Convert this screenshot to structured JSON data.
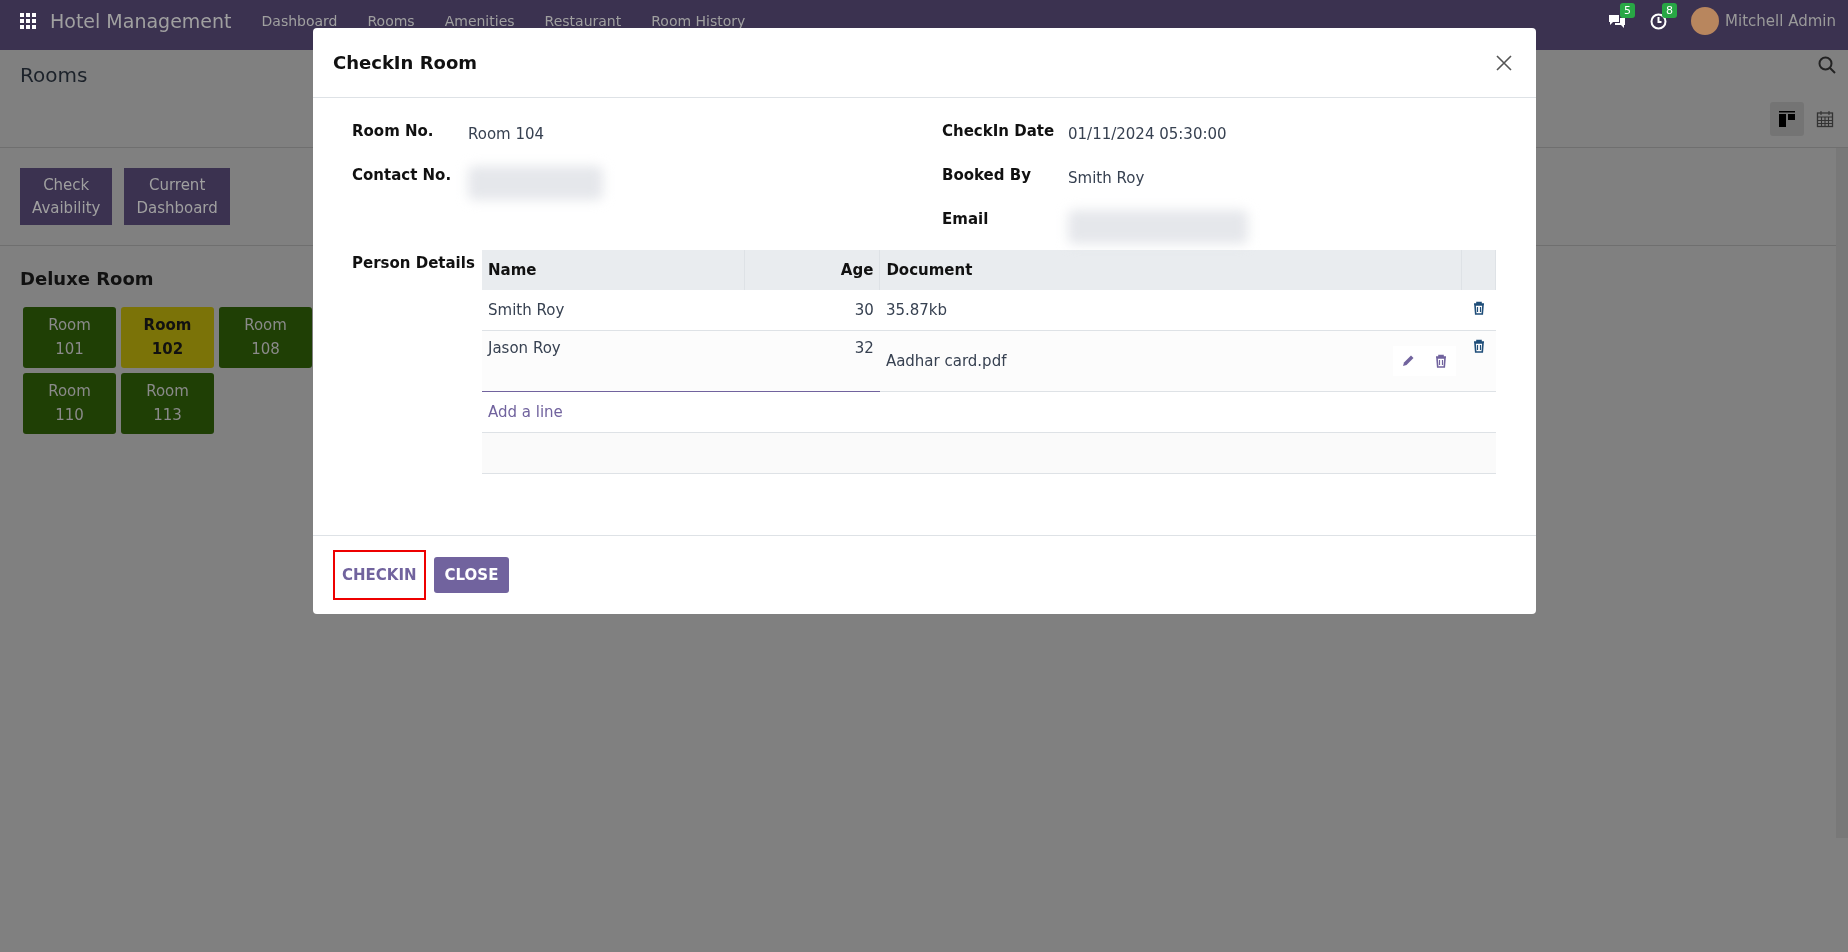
{
  "navbar": {
    "app_title": "Hotel Management",
    "menu": [
      {
        "label": "Dashboard"
      },
      {
        "label": "Rooms"
      },
      {
        "label": "Amenities"
      },
      {
        "label": "Restaurant"
      },
      {
        "label": "Room History"
      }
    ],
    "messages_count": "5",
    "activities_count": "8",
    "user_name": "Mitchell Admin"
  },
  "page": {
    "title": "Rooms",
    "buttons": [
      {
        "lines": [
          "Check",
          "Avaibility"
        ]
      },
      {
        "lines": [
          "Current",
          "Dashboard"
        ]
      }
    ],
    "section_title": "Deluxe Room",
    "rooms": [
      {
        "lines": [
          "Room",
          "101"
        ],
        "color": "#1f3f05"
      },
      {
        "lines": [
          "Room",
          "102"
        ],
        "color": "#7b7308"
      },
      {
        "lines": [
          "Room",
          "108"
        ],
        "color": "#1f3f05"
      },
      {
        "lines": [
          "Room",
          "110"
        ],
        "color": "#1f3f05"
      },
      {
        "lines": [
          "Room",
          "113"
        ],
        "color": "#1f3f05"
      }
    ]
  },
  "dialog": {
    "title": "CheckIn Room",
    "left_fields": [
      {
        "label": "Room No.",
        "value": "Room 104"
      },
      {
        "label": "Contact No."
      }
    ],
    "right_fields": [
      {
        "label": "CheckIn Date",
        "value": "01/11/2024 05:30:00"
      },
      {
        "label": "Booked By",
        "value": "Smith Roy"
      },
      {
        "label": "Email"
      }
    ],
    "persons": {
      "label": "Person Details",
      "columns": [
        "Name",
        "Age",
        "Document"
      ],
      "rows": [
        {
          "name": "Smith Roy",
          "age": "30",
          "document": "35.87kb",
          "editing": false
        },
        {
          "name": "Jason Roy",
          "age": "32",
          "document": "Aadhar card.pdf",
          "editing": true
        }
      ],
      "add_line": "Add a line"
    },
    "buttons": [
      {
        "label": "CHECKIN",
        "kind": "link",
        "highlighted": true
      },
      {
        "label": "CLOSE",
        "kind": "primary",
        "highlighted": false
      }
    ]
  }
}
